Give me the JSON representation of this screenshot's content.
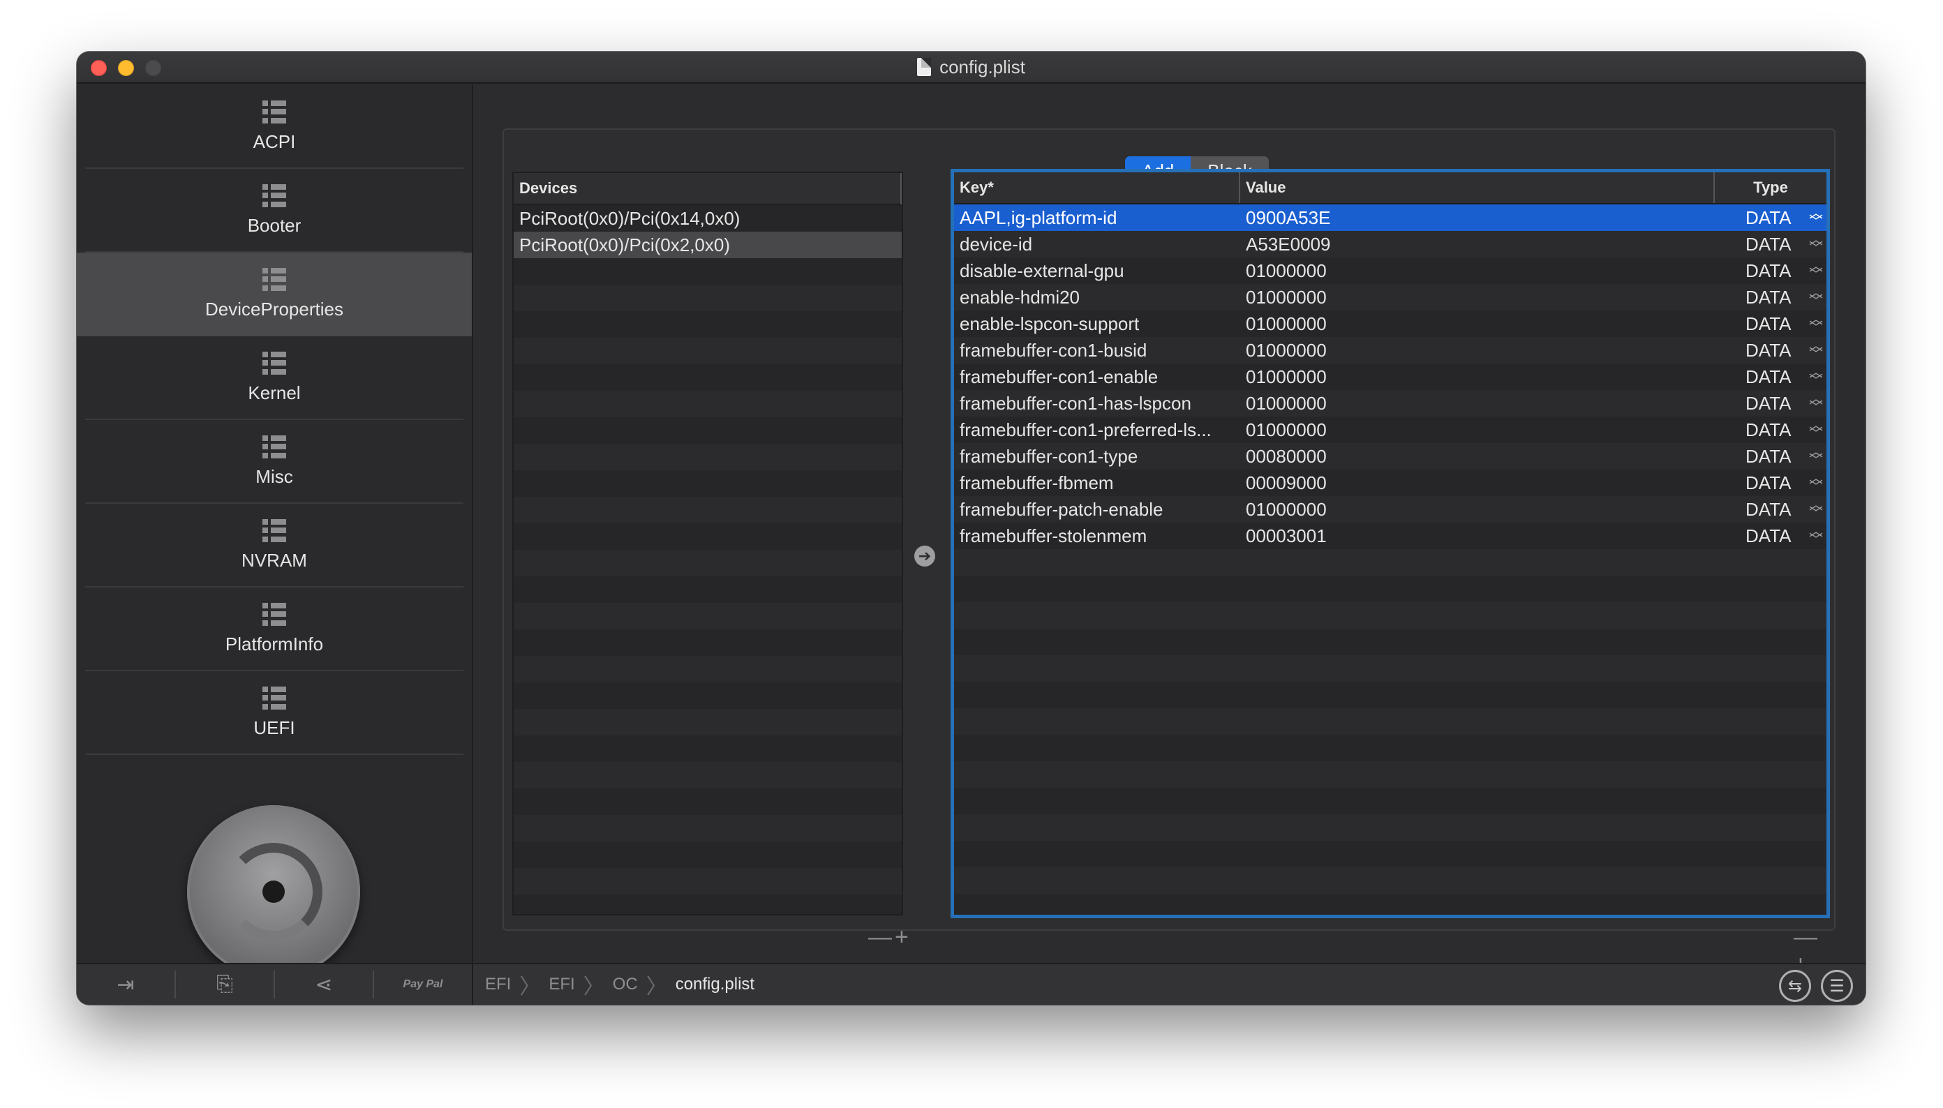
{
  "window": {
    "title": "config.plist"
  },
  "sidebar": {
    "items": [
      {
        "label": "ACPI"
      },
      {
        "label": "Booter"
      },
      {
        "label": "DeviceProperties",
        "active": true
      },
      {
        "label": "Kernel"
      },
      {
        "label": "Misc"
      },
      {
        "label": "NVRAM"
      },
      {
        "label": "PlatformInfo"
      },
      {
        "label": "UEFI"
      }
    ]
  },
  "segmented": {
    "add": "Add",
    "block": "Block"
  },
  "devices": {
    "header": "Devices",
    "rows": [
      "PciRoot(0x0)/Pci(0x14,0x0)",
      "PciRoot(0x0)/Pci(0x2,0x0)"
    ],
    "pm": "—+"
  },
  "table": {
    "headers": {
      "key": "Key*",
      "value": "Value",
      "type": "Type"
    },
    "rows": [
      {
        "key": "AAPL,ig-platform-id",
        "value": "0900A53E",
        "type": "DATA"
      },
      {
        "key": "device-id",
        "value": "A53E0009",
        "type": "DATA"
      },
      {
        "key": "disable-external-gpu",
        "value": "01000000",
        "type": "DATA"
      },
      {
        "key": "enable-hdmi20",
        "value": "01000000",
        "type": "DATA"
      },
      {
        "key": "enable-lspcon-support",
        "value": "01000000",
        "type": "DATA"
      },
      {
        "key": "framebuffer-con1-busid",
        "value": "01000000",
        "type": "DATA"
      },
      {
        "key": "framebuffer-con1-enable",
        "value": "01000000",
        "type": "DATA"
      },
      {
        "key": "framebuffer-con1-has-lspcon",
        "value": "01000000",
        "type": "DATA"
      },
      {
        "key": "framebuffer-con1-preferred-ls...",
        "value": "01000000",
        "type": "DATA"
      },
      {
        "key": "framebuffer-con1-type",
        "value": "00080000",
        "type": "DATA"
      },
      {
        "key": "framebuffer-fbmem",
        "value": "00009000",
        "type": "DATA"
      },
      {
        "key": "framebuffer-patch-enable",
        "value": "01000000",
        "type": "DATA"
      },
      {
        "key": "framebuffer-stolenmem",
        "value": "00003001",
        "type": "DATA"
      }
    ],
    "pm": "—+"
  },
  "bottombar": {
    "paypal": "Pay Pal",
    "breadcrumb": [
      "EFI",
      "EFI",
      "OC",
      "config.plist"
    ]
  },
  "colors": {
    "accent": "#1b6fe0",
    "selection": "#1a5fd0",
    "focus_ring": "#2570b8"
  }
}
